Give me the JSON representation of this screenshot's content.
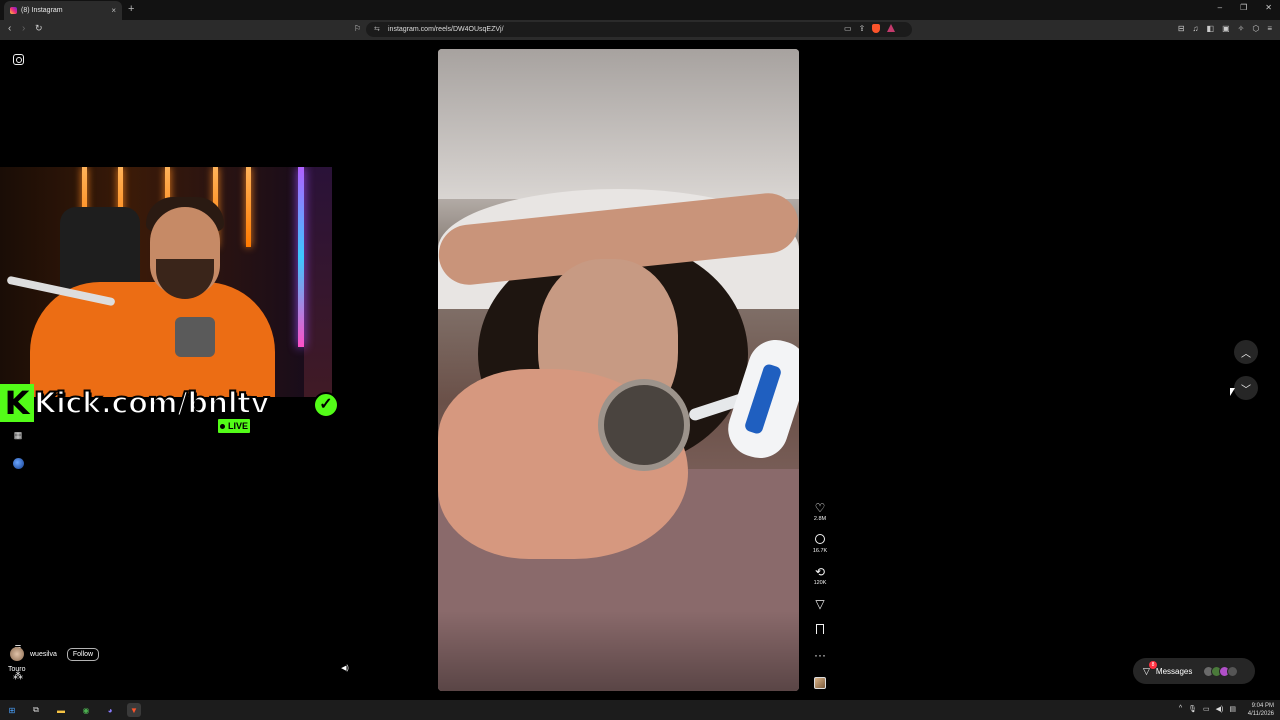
{
  "browser": {
    "tab_title": "(8) Instagram",
    "tab_close": "×",
    "new_tab": "+",
    "url": "instagram.com/reels/DW4OUsqEZVj/",
    "window_controls": [
      "–",
      "❐",
      "✕"
    ]
  },
  "webcam_overlay": {
    "kick_text": "Kick.com/bnltv",
    "kick_letter": "K",
    "live_label": "LIVE"
  },
  "reel": {
    "username": "wuesilva",
    "follow_label": "Follow",
    "audio_label": "Touro",
    "actions": {
      "likes": "2.8M",
      "comments": "16.7K",
      "reposts": "120K",
      "more": "···"
    }
  },
  "messages": {
    "label": "Messages",
    "badge": "8"
  },
  "taskbar": {
    "time": "9:04 PM",
    "date": "4/11/2026"
  },
  "colors": {
    "kick_green": "#53fc18",
    "notification_red": "#ff3040",
    "brave_orange": "#fb542b"
  }
}
